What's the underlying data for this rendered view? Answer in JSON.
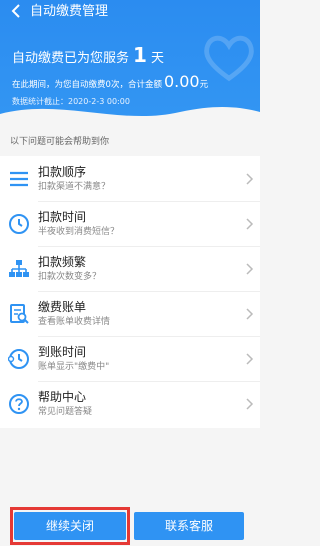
{
  "header": {
    "title": "自动缴费管理",
    "service_prefix": "自动缴费已为您服务",
    "service_days": "1",
    "service_suffix": "天",
    "amount_prefix": "在此期间，为您自动缴费",
    "payment_count": "0",
    "amount_mid": "次，合计金额",
    "total_amount": "0.00",
    "amount_unit": "元",
    "stat_label": "数据统计截止：",
    "stat_date": "2020-2-3 00:00"
  },
  "help": {
    "title": "以下问题可能会帮助到你",
    "items": [
      {
        "label": "扣款顺序",
        "sub": "扣款渠道不满意？",
        "icon": "list-icon"
      },
      {
        "label": "扣款时间",
        "sub": "半夜收到消费短信？",
        "icon": "clock-icon"
      },
      {
        "label": "扣款频繁",
        "sub": "扣款次数变多？",
        "icon": "hierarchy-icon"
      },
      {
        "label": "缴费账单",
        "sub": "查看账单收费详情",
        "icon": "bill-search-icon"
      },
      {
        "label": "到账时间",
        "sub": "账单显示\"缴费中\"",
        "icon": "clock-alert-icon"
      },
      {
        "label": "帮助中心",
        "sub": "常见问题答疑",
        "icon": "question-icon"
      }
    ]
  },
  "footer": {
    "continue_close": "继续关闭",
    "contact_service": "联系客服"
  },
  "colors": {
    "primary": "#2f93f3",
    "highlight": "#e53935"
  }
}
